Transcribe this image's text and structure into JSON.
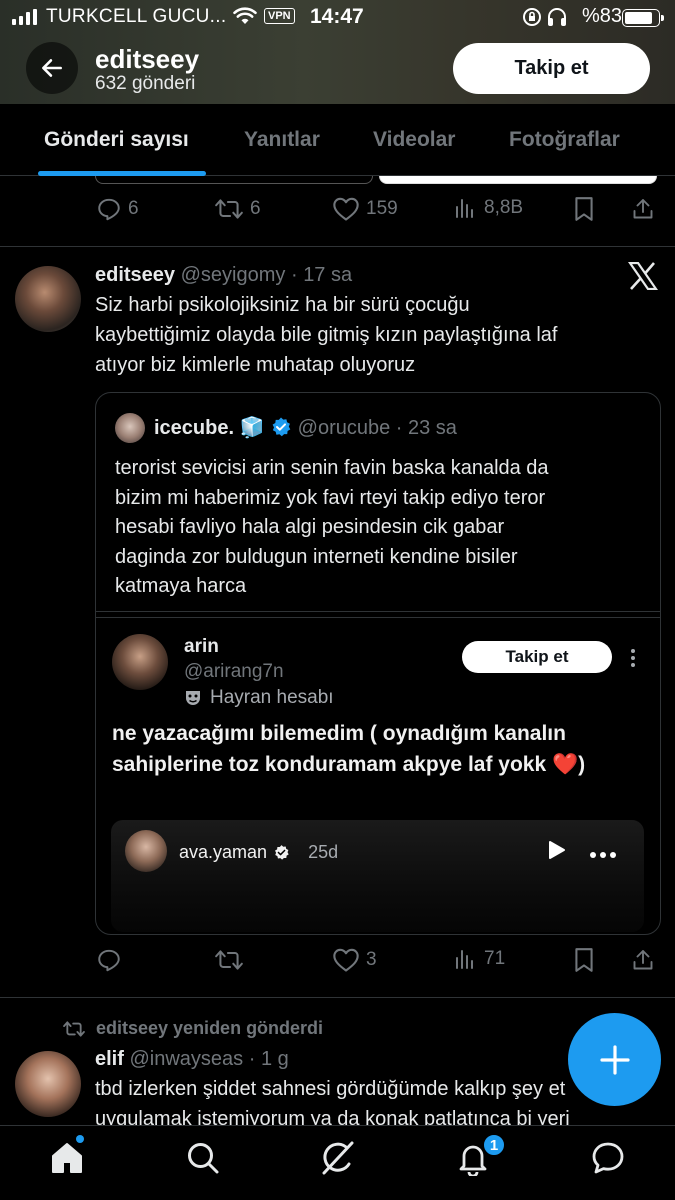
{
  "status_bar": {
    "carrier": "TURKCELL GUCU...",
    "vpn": "VPN",
    "time": "14:47",
    "battery": "%83",
    "battery_level": 0.83
  },
  "header": {
    "name": "editseey",
    "post_count": "632 gönderi",
    "follow_label": "Takip et"
  },
  "tabs": [
    {
      "label": "Gönderi sayısı",
      "active": true
    },
    {
      "label": "Yanıtlar"
    },
    {
      "label": "Videolar"
    },
    {
      "label": "Fotoğraflar"
    }
  ],
  "prev_tweet": {
    "replies": "6",
    "retweets": "6",
    "likes": "159",
    "views": "8,8B"
  },
  "tweet": {
    "name": "editseey",
    "handle": "@seyigomy",
    "time": "17 sa",
    "text_lines": [
      "Siz harbi psikolojiksiniz ha bir sürü çocuğu",
      "kaybettiğimiz olayda bile gitmiş kızın paylaştığına laf",
      "atıyor biz kimlerle muhatap oluyoruz"
    ],
    "quote": {
      "name": "icecube.",
      "emoji": "🧊",
      "handle": "@orucube",
      "time": "23 sa",
      "text_lines": [
        "terorist sevicisi arin senin favin baska kanalda da",
        "bizim mi haberimiz yok favi rteyi takip ediyo teror",
        "hesabi favliyo hala algi pesindesin cik gabar",
        "daginda zor buldugun interneti kendine bisiler",
        "katmaya harca"
      ],
      "embed": {
        "name": "arin",
        "handle": "@arirang7n",
        "fan_label": "Hayran hesabı",
        "follow_label": "Takip et",
        "text_lines": [
          "ne yazacağımı bilemedim ( oynadığım kanalın",
          "sahiplerine toz konduramam akpye laf yokk ❤️)"
        ],
        "video_author": "ava.yaman",
        "video_age": "25d"
      }
    },
    "replies": "",
    "retweets": "",
    "likes": "3",
    "views": "71"
  },
  "next_tweet": {
    "repost_label": "editseey yeniden gönderdi",
    "name": "elif",
    "handle": "@inwayseas",
    "time": "1 g",
    "text_lines": [
      "tbd izlerken şiddet sahnesi gördüğümde kalkıp şey et",
      "uygulamak istemiyorum ya da konak patlatınca bi yeri"
    ]
  },
  "bottom_nav": {
    "notification_count": "1"
  },
  "colors": {
    "accent": "#1d9bf0",
    "muted": "#71767b",
    "text": "#e7e9ea",
    "divider": "#2f3336"
  }
}
